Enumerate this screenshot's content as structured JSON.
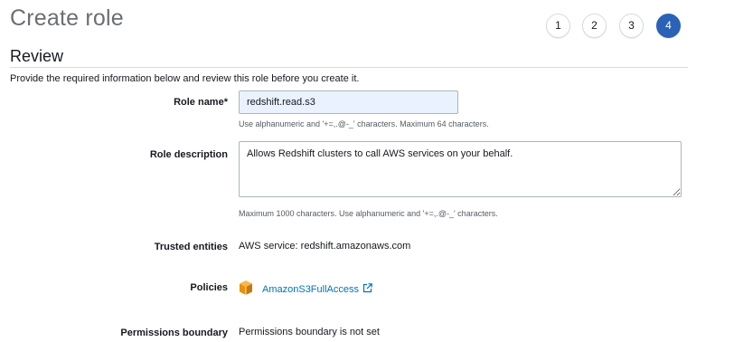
{
  "page": {
    "title": "Create role"
  },
  "steps": [
    {
      "label": "1"
    },
    {
      "label": "2"
    },
    {
      "label": "3"
    },
    {
      "label": "4"
    }
  ],
  "review": {
    "title": "Review",
    "intro": "Provide the required information below and review this role before you create it."
  },
  "role_name": {
    "label": "Role name*",
    "value": "redshift.read.s3",
    "hint": "Use alphanumeric and '+=,.@-_' characters. Maximum 64 characters."
  },
  "role_description": {
    "label": "Role description",
    "value": "Allows Redshift clusters to call AWS services on your behalf.",
    "hint": "Maximum 1000 characters. Use alphanumeric and '+=,.@-_' characters."
  },
  "trusted_entities": {
    "label": "Trusted entities",
    "value": "AWS service: redshift.amazonaws.com"
  },
  "policies": {
    "label": "Policies",
    "items": [
      {
        "name": "AmazonS3FullAccess",
        "icon": "aws-policy-cube-icon"
      }
    ]
  },
  "permissions_boundary": {
    "label": "Permissions boundary",
    "value": "Permissions boundary is not set"
  },
  "colors": {
    "active_step": "#2a62b8",
    "link": "#0073bb",
    "policy_icon": "#f39c12",
    "input_bg": "#eaf2ff"
  }
}
